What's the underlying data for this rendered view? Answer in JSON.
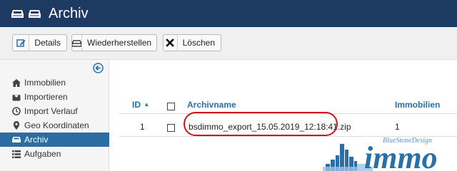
{
  "header": {
    "title": "Archiv"
  },
  "toolbar": {
    "details_label": "Details",
    "restore_label": "Wiederherstellen",
    "delete_label": "Löschen"
  },
  "sidebar": {
    "items": [
      {
        "label": "Immobilien",
        "icon": "home-icon",
        "active": false
      },
      {
        "label": "Importieren",
        "icon": "import-icon",
        "active": false
      },
      {
        "label": "Import Verlauf",
        "icon": "clock-icon",
        "active": false
      },
      {
        "label": "Geo Koordinaten",
        "icon": "map-marker-icon",
        "active": false
      },
      {
        "label": "Archiv",
        "icon": "archive-icon",
        "active": true
      },
      {
        "label": "Aufgaben",
        "icon": "list-icon",
        "active": false
      }
    ]
  },
  "table": {
    "columns": {
      "id": "ID",
      "archivename": "Archivname",
      "immobilien": "Immobilien"
    },
    "sort_indicator": "▲",
    "rows": [
      {
        "id": "1",
        "archivename": "bsdimmo_export_15.05.2019_12:18:41.zip",
        "immobilien": "1"
      }
    ]
  },
  "watermark": {
    "brand": "BlueStoneDesign",
    "text": "immo"
  },
  "colors": {
    "header_bg": "#1d3a63",
    "active_nav": "#2d6ca2",
    "link": "#2a6ea8",
    "highlight": "#d0121b"
  }
}
